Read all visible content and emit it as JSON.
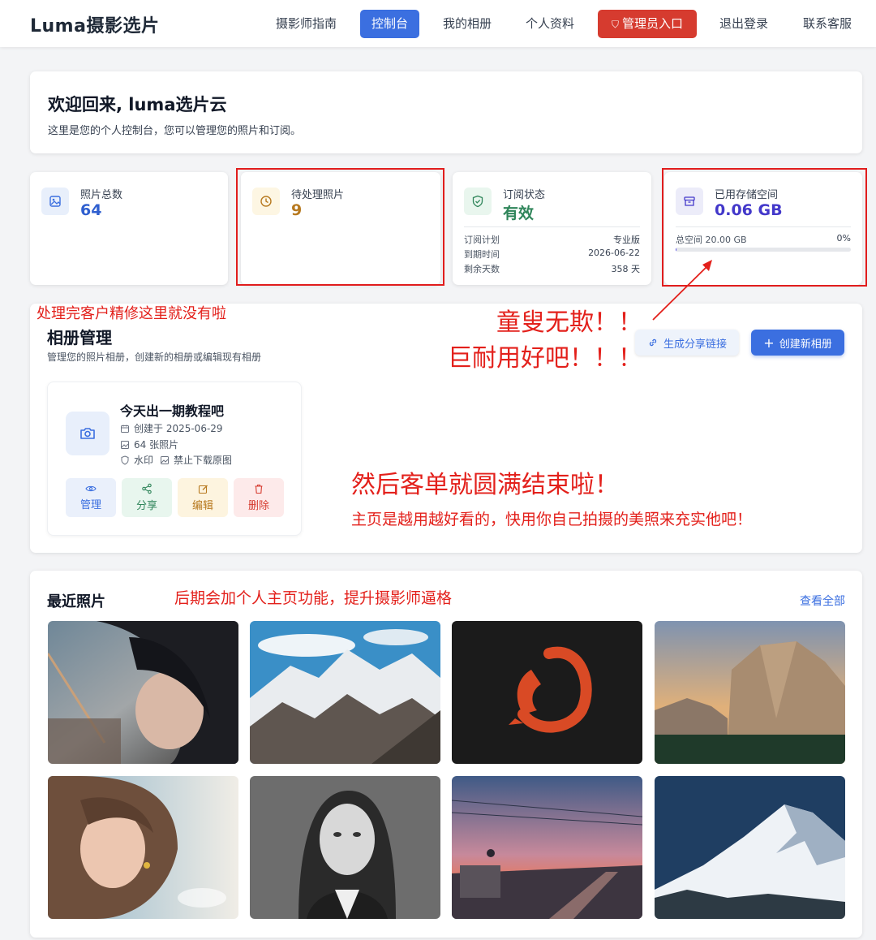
{
  "nav": {
    "brand": "Luma摄影选片",
    "items": [
      {
        "label": "摄影师指南"
      },
      {
        "label": "控制台"
      },
      {
        "label": "我的相册"
      },
      {
        "label": "个人资料"
      },
      {
        "label": "管理员入口"
      },
      {
        "label": "退出登录"
      },
      {
        "label": "联系客服"
      }
    ]
  },
  "welcome": {
    "title": "欢迎回来, luma选片云",
    "subtitle": "这里是您的个人控制台，您可以管理您的照片和订阅。"
  },
  "stats": {
    "photos": {
      "label": "照片总数",
      "value": "64"
    },
    "pending": {
      "label": "待处理照片",
      "value": "9"
    },
    "subscription": {
      "label": "订阅状态",
      "value": "有效",
      "rows": [
        {
          "k": "订阅计划",
          "v": "专业版"
        },
        {
          "k": "到期时间",
          "v": "2026-06-22"
        },
        {
          "k": "剩余天数",
          "v": "358 天"
        }
      ]
    },
    "storage": {
      "label": "已用存储空间",
      "value": "0.06 GB",
      "total_label": "总空间 20.00 GB",
      "percent_text": "0%",
      "percent": 0.003
    }
  },
  "albums": {
    "title": "相册管理",
    "subtitle": "管理您的照片相册，创建新的相册或编辑现有相册",
    "share_button": "生成分享链接",
    "create_button": "创建新相册",
    "card": {
      "name": "今天出一期教程吧",
      "created": "创建于 2025-06-29",
      "count": "64 张照片",
      "watermark": "水印",
      "no_download": "禁止下载原图",
      "actions": [
        {
          "label": "管理"
        },
        {
          "label": "分享"
        },
        {
          "label": "编辑"
        },
        {
          "label": "删除"
        }
      ]
    }
  },
  "recent": {
    "title": "最近照片",
    "view_all": "查看全部",
    "photos": [
      {
        "subject": "archer-illustration"
      },
      {
        "subject": "snowy-mountains"
      },
      {
        "subject": "red-koi-ink"
      },
      {
        "subject": "granite-cliff"
      },
      {
        "subject": "girl-portrait-painting"
      },
      {
        "subject": "bw-woman-portrait"
      },
      {
        "subject": "sunset-rooftop"
      },
      {
        "subject": "snow-peak-night"
      }
    ]
  },
  "annotations": {
    "a1": "处理完客户精修这里就没有啦",
    "a2": "童叟无欺！！",
    "a3": "巨耐用好吧！！！",
    "a4": "然后客单就圆满结束啦！",
    "a5": "主页是越用越好看的，快用你自己拍摄的美照来充实他吧！",
    "a6": "后期会加个人主页功能，提升摄影师逼格"
  },
  "colors": {
    "primary": "#3b6fe0",
    "admin": "#d63b2f",
    "annotation": "#e3201b",
    "pending": "#b7791f",
    "active": "#2f855a",
    "storage": "#4338ca"
  }
}
